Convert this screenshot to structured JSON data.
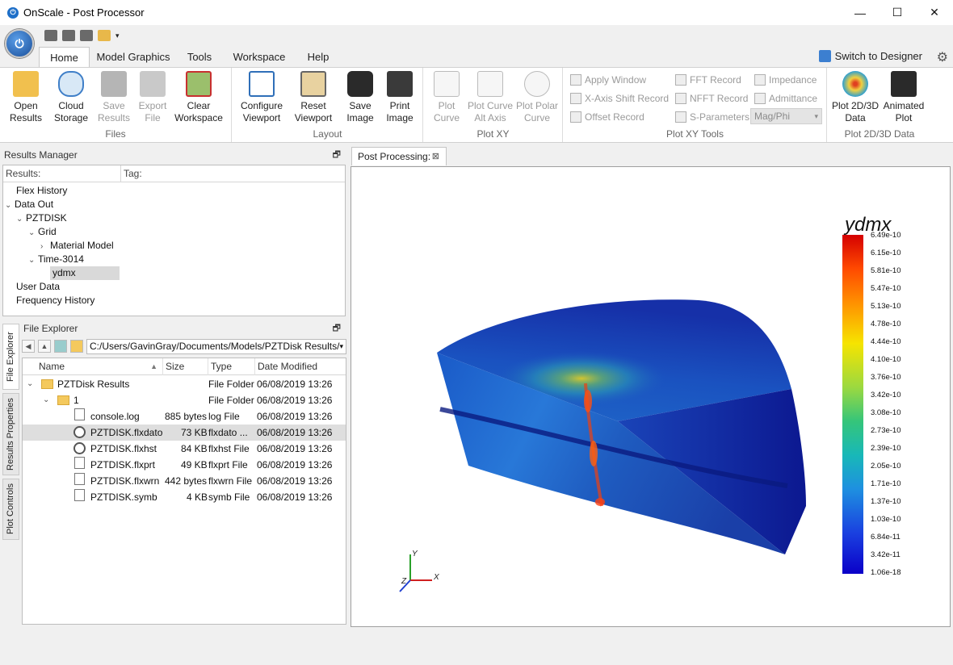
{
  "window": {
    "title": "OnScale - Post Processor",
    "min": "—",
    "max": "☐",
    "close": "✕"
  },
  "ribbon_tabs": [
    "Home",
    "Model Graphics",
    "Tools",
    "Workspace",
    "Help"
  ],
  "switch_label": "Switch to Designer",
  "ribbon": {
    "files": {
      "label": "Files",
      "buttons": [
        {
          "line1": "Open",
          "line2": "Results"
        },
        {
          "line1": "Cloud",
          "line2": "Storage"
        },
        {
          "line1": "Save",
          "line2": "Results"
        },
        {
          "line1": "Export",
          "line2": "File"
        },
        {
          "line1": "Clear",
          "line2": "Workspace"
        }
      ]
    },
    "layout": {
      "label": "Layout",
      "buttons": [
        {
          "line1": "Configure",
          "line2": "Viewport"
        },
        {
          "line1": "Reset",
          "line2": "Viewport"
        },
        {
          "line1": "Save",
          "line2": "Image"
        },
        {
          "line1": "Print",
          "line2": "Image"
        }
      ]
    },
    "plotxy": {
      "label": "Plot XY",
      "buttons": [
        {
          "line1": "Plot",
          "line2": "Curve"
        },
        {
          "line1": "Plot Curve",
          "line2": "Alt Axis"
        },
        {
          "line1": "Plot Polar",
          "line2": "Curve"
        }
      ]
    },
    "plotxytools": {
      "label": "Plot XY Tools",
      "items": [
        "Apply Window",
        "X-Axis Shift Record",
        "Offset Record",
        "FFT Record",
        "NFFT Record",
        "S-Parameters",
        "Impedance",
        "Admittance"
      ],
      "select": "Mag/Phi"
    },
    "plot2d3d": {
      "label": "Plot 2D/3D Data",
      "buttons": [
        {
          "line1": "Plot 2D/3D",
          "line2": "Data"
        },
        {
          "line1": "Animated",
          "line2": "Plot"
        }
      ]
    }
  },
  "results_manager": {
    "title": "Results Manager",
    "col_results": "Results:",
    "col_tag": "Tag:",
    "tree": [
      "Flex History",
      "Data Out",
      "PZTDISK",
      "Grid",
      "Material Model",
      "Time-3014",
      "ydmx",
      "User Data",
      "Frequency History"
    ]
  },
  "file_explorer": {
    "title": "File Explorer",
    "path": "C:/Users/GavinGray/Documents/Models/PZTDisk Results/",
    "columns": [
      "Name",
      "Size",
      "Type",
      "Date Modified"
    ],
    "rows": [
      {
        "name": "PZTDisk Results",
        "size": "",
        "type": "File Folder",
        "date": "06/08/2019 13:26"
      },
      {
        "name": "1",
        "size": "",
        "type": "File Folder",
        "date": "06/08/2019 13:26"
      },
      {
        "name": "console.log",
        "size": "885 bytes",
        "type": "log File",
        "date": "06/08/2019 13:26"
      },
      {
        "name": "PZTDISK.flxdato",
        "size": "73 KB",
        "type": "flxdato ...",
        "date": "06/08/2019 13:26"
      },
      {
        "name": "PZTDISK.flxhst",
        "size": "84 KB",
        "type": "flxhst File",
        "date": "06/08/2019 13:26"
      },
      {
        "name": "PZTDISK.flxprt",
        "size": "49 KB",
        "type": "flxprt File",
        "date": "06/08/2019 13:26"
      },
      {
        "name": "PZTDISK.flxwrn",
        "size": "442 bytes",
        "type": "flxwrn File",
        "date": "06/08/2019 13:26"
      },
      {
        "name": "PZTDISK.symb",
        "size": "4 KB",
        "type": "symb File",
        "date": "06/08/2019 13:26"
      }
    ]
  },
  "side_tabs": [
    "File Explorer",
    "Results Properties",
    "Plot Controls"
  ],
  "viewport": {
    "tab_label": "Post Processing:",
    "legend_title": "ydmx",
    "legend_ticks": [
      "6.49e-10",
      "6.15e-10",
      "5.81e-10",
      "5.47e-10",
      "5.13e-10",
      "4.78e-10",
      "4.44e-10",
      "4.10e-10",
      "3.76e-10",
      "3.42e-10",
      "3.08e-10",
      "2.73e-10",
      "2.39e-10",
      "2.05e-10",
      "1.71e-10",
      "1.37e-10",
      "1.03e-10",
      "6.84e-11",
      "3.42e-11",
      "1.06e-18"
    ],
    "axes": {
      "x": "X",
      "y": "Y",
      "z": "Z"
    }
  },
  "colors": {
    "accent": "#1e6fc8",
    "selection": "#d9d9d9"
  }
}
